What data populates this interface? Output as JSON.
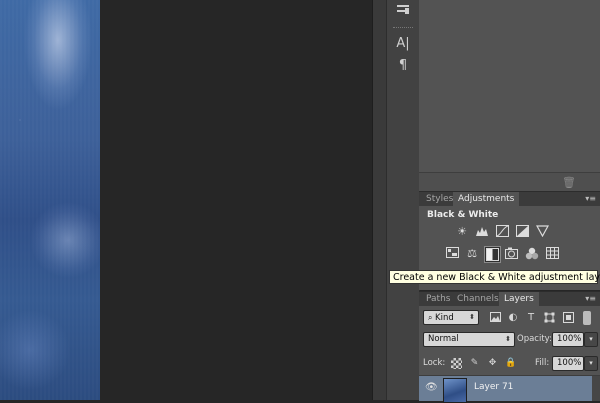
{
  "tool_strip": {
    "icons": [
      "brush-preset-icon",
      "character-icon",
      "paragraph-icon"
    ],
    "character_glyph": "A|",
    "paragraph_glyph": "¶"
  },
  "upper_panel": {
    "trash_glyph": "🗑"
  },
  "adjustments_panel": {
    "tabs": [
      {
        "label": "Styles",
        "active": false
      },
      {
        "label": "Adjustments",
        "active": true
      }
    ],
    "menu_glyph": "▾≡",
    "title": "Black & White",
    "row1": [
      "brightness-contrast-icon",
      "levels-icon",
      "curves-icon",
      "exposure-icon",
      "vibrance-icon"
    ],
    "row2": [
      "hue-saturation-icon",
      "color-balance-icon",
      "black-white-icon",
      "photo-filter-icon",
      "channel-mixer-icon",
      "color-lookup-icon"
    ]
  },
  "tooltip": {
    "text": "Create a new Black & White adjustment layer"
  },
  "layers_panel": {
    "tabs": [
      {
        "label": "Paths",
        "active": false
      },
      {
        "label": "Channels",
        "active": false
      },
      {
        "label": "Layers",
        "active": true
      }
    ],
    "menu_glyph": "▾≡",
    "filter_kind": "Kind",
    "blend_mode": "Normal",
    "opacity_label": "Opacity:",
    "opacity_value": "100%",
    "lock_label": "Lock:",
    "fill_label": "Fill:",
    "fill_value": "100%",
    "layers": [
      {
        "name": "Layer 71",
        "visible": true,
        "selected": true
      }
    ]
  }
}
